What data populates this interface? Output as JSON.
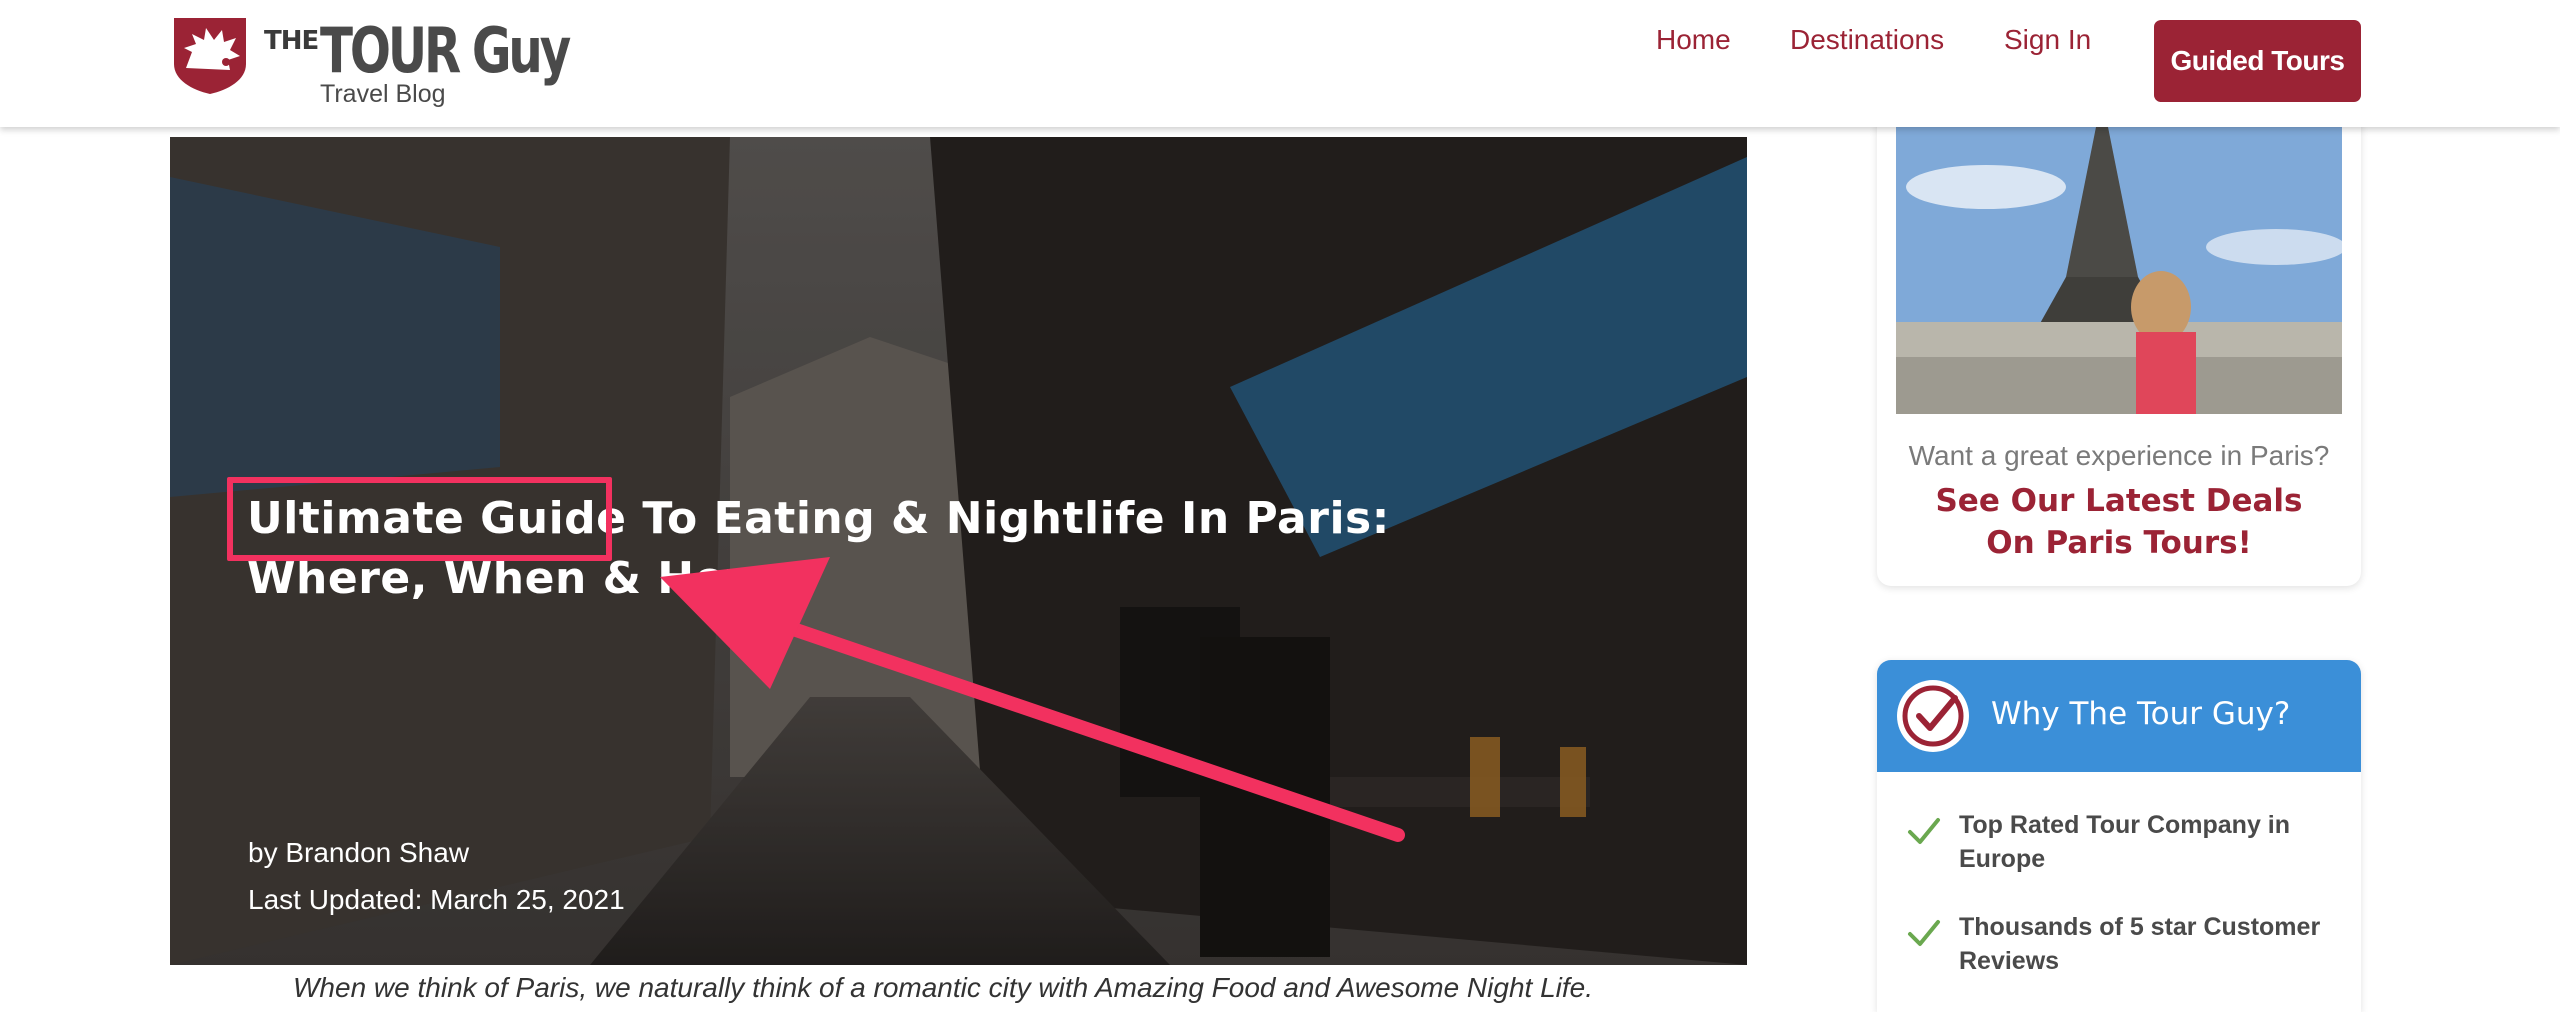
{
  "header": {
    "logo": {
      "the": "THE",
      "brand": "TOUR Guy",
      "sub": "Travel Blog"
    },
    "nav": {
      "home": "Home",
      "destinations": "Destinations",
      "sign_in": "Sign In",
      "cta": "Guided Tours"
    }
  },
  "hero": {
    "title": "Ultimate Guide To Eating & Nightlife In Paris: Where, When & How",
    "author": "by Brandon Shaw",
    "updated": "Last Updated: March 25, 2021",
    "highlight_color": "#f2315f"
  },
  "article": {
    "caption": "When we think of Paris, we naturally think of a romantic city with Amazing Food and Awesome Night Life."
  },
  "sidebar": {
    "promo": {
      "question": "Want a great experience in Paris?",
      "deal": "See Our Latest Deals On Paris Tours!"
    },
    "why": {
      "title": "Why The Tour Guy?",
      "items": [
        "Top Rated Tour Company in Europe",
        "Thousands of 5 star Customer Reviews"
      ]
    }
  },
  "colors": {
    "brand": "#9b2335",
    "accent_blue": "#3b8fd8",
    "check_green": "#6aa84f"
  },
  "icons": {
    "logo": "hedgehog-badge-icon",
    "check": "check-icon",
    "badge": "check-badge-icon"
  }
}
